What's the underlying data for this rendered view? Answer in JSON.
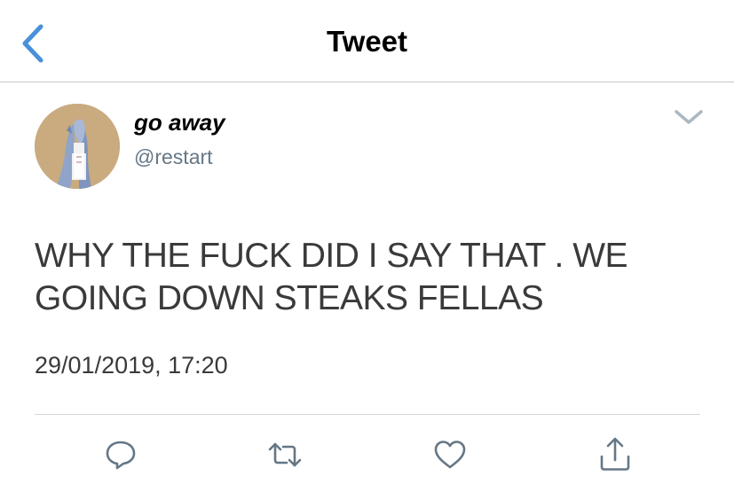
{
  "header": {
    "title": "Tweet",
    "back_icon": "chevron-left-icon"
  },
  "author": {
    "display_name": "go away",
    "handle": "@restart",
    "avatar_bg": "#c9ab7f"
  },
  "tweet": {
    "lines": [
      "WHY THE FUCK DID I SAY THAT . WE",
      "GOING DOWN STEAKS FELLAS"
    ],
    "timestamp": "29/01/2019, 17:20"
  },
  "actions": [
    {
      "name": "reply",
      "icon": "reply-icon"
    },
    {
      "name": "retweet",
      "icon": "retweet-icon"
    },
    {
      "name": "like",
      "icon": "heart-icon"
    },
    {
      "name": "share",
      "icon": "share-icon"
    }
  ],
  "colors": {
    "accent": "#1da1f2",
    "back_arrow": "#4a90d9",
    "secondary_text": "#657786",
    "icon_gray": "#657786"
  }
}
